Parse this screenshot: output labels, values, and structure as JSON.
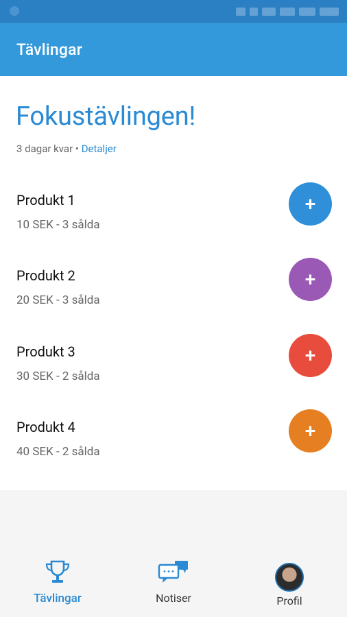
{
  "app": {
    "title": "Tävlingar"
  },
  "contest": {
    "title": "Fokustävlingen!",
    "remaining": "3 dagar kvar",
    "separator": "•",
    "details_label": "Detaljer"
  },
  "products": [
    {
      "name": "Produkt 1",
      "meta": "10 SEK - 3 sålda",
      "button_icon": "+",
      "color": "#2f8fd8"
    },
    {
      "name": "Produkt 2",
      "meta": "20 SEK - 3 sålda",
      "button_icon": "+",
      "color": "#9b59b6"
    },
    {
      "name": "Produkt 3",
      "meta": "30 SEK - 2 sålda",
      "button_icon": "+",
      "color": "#e74c3c"
    },
    {
      "name": "Produkt 4",
      "meta": "40 SEK - 2 sålda",
      "button_icon": "+",
      "color": "#e67e22"
    }
  ],
  "nav": {
    "items": [
      {
        "label": "Tävlingar",
        "icon": "trophy-icon",
        "active": true
      },
      {
        "label": "Notiser",
        "icon": "chat-icon",
        "active": false
      },
      {
        "label": "Profil",
        "icon": "avatar",
        "active": false
      }
    ]
  },
  "colors": {
    "accent": "#2a8ad3",
    "appbar": "#3399db",
    "statusbar": "#2b7fc3"
  }
}
